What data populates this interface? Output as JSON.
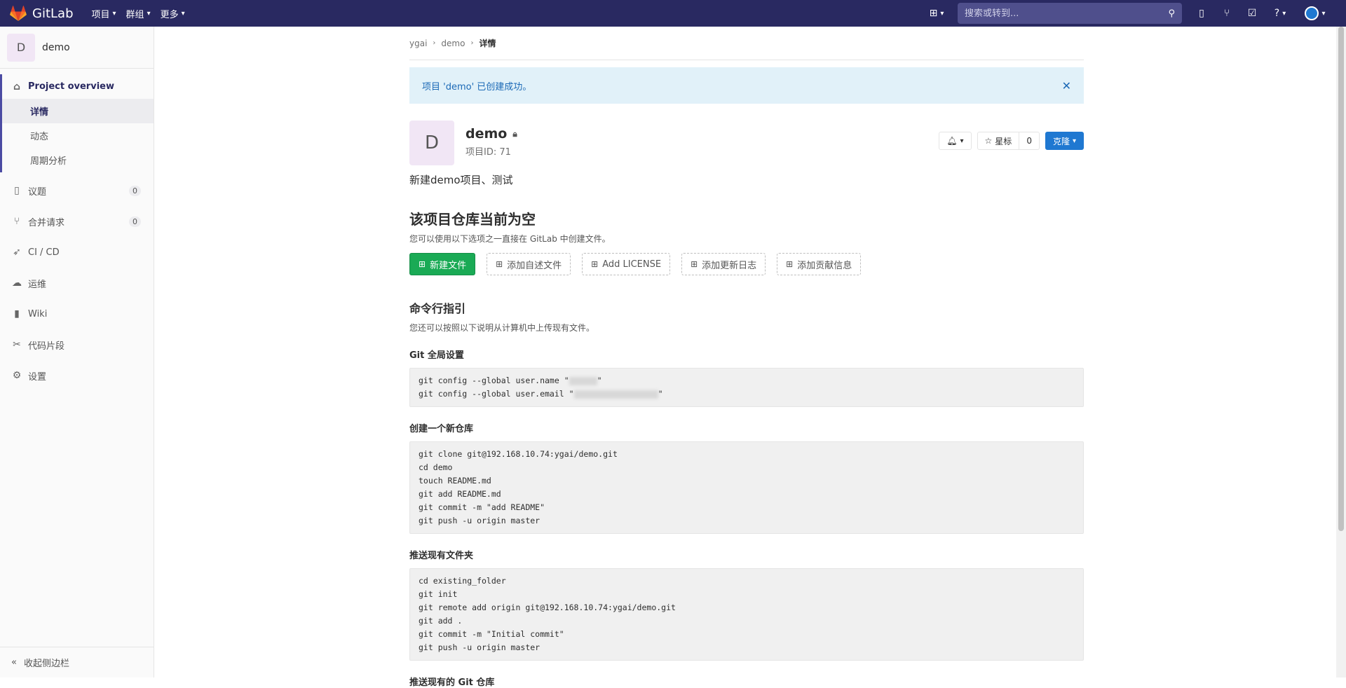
{
  "topbar": {
    "logo_text": "GitLab",
    "nav": [
      "项目",
      "群组",
      "更多"
    ],
    "search_placeholder": "搜索或转到..."
  },
  "sidebar": {
    "project_initial": "D",
    "project_name": "demo",
    "overview_label": "Project overview",
    "sub_items": [
      "详情",
      "动态",
      "周期分析"
    ],
    "items": [
      {
        "label": "议题",
        "badge": "0"
      },
      {
        "label": "合并请求",
        "badge": "0"
      },
      {
        "label": "CI / CD"
      },
      {
        "label": "运维"
      },
      {
        "label": "Wiki"
      },
      {
        "label": "代码片段"
      },
      {
        "label": "设置"
      }
    ],
    "collapse_label": "收起侧边栏"
  },
  "breadcrumb": [
    "ygai",
    "demo",
    "详情"
  ],
  "alert": {
    "text": "项目 'demo' 已创建成功。"
  },
  "project": {
    "initial": "D",
    "name": "demo",
    "id_label": "项目ID: 71",
    "star_label": "星标",
    "star_count": "0",
    "clone_label": "克隆",
    "description": "新建demo项目、测试"
  },
  "empty": {
    "title": "该项目仓库当前为空",
    "subtitle": "您可以使用以下选项之一直接在 GitLab 中创建文件。",
    "buttons": [
      "新建文件",
      "添加自述文件",
      "Add LICENSE",
      "添加更新日志",
      "添加贡献信息"
    ]
  },
  "cli": {
    "title": "命令行指引",
    "subtitle": "您还可以按照以下说明从计算机中上传现有文件。",
    "global_title": "Git 全局设置",
    "global_line1_prefix": "git config --global user.name \"",
    "global_line2_prefix": "git config --global user.email \"",
    "quote": "\"",
    "new_repo_title": "创建一个新仓库",
    "new_repo_code": "git clone git@192.168.10.74:ygai/demo.git\ncd demo\ntouch README.md\ngit add README.md\ngit commit -m \"add README\"\ngit push -u origin master",
    "push_folder_title": "推送现有文件夹",
    "push_folder_code": "cd existing_folder\ngit init\ngit remote add origin git@192.168.10.74:ygai/demo.git\ngit add .\ngit commit -m \"Initial commit\"\ngit push -u origin master",
    "push_repo_title": "推送现有的 Git 仓库"
  }
}
